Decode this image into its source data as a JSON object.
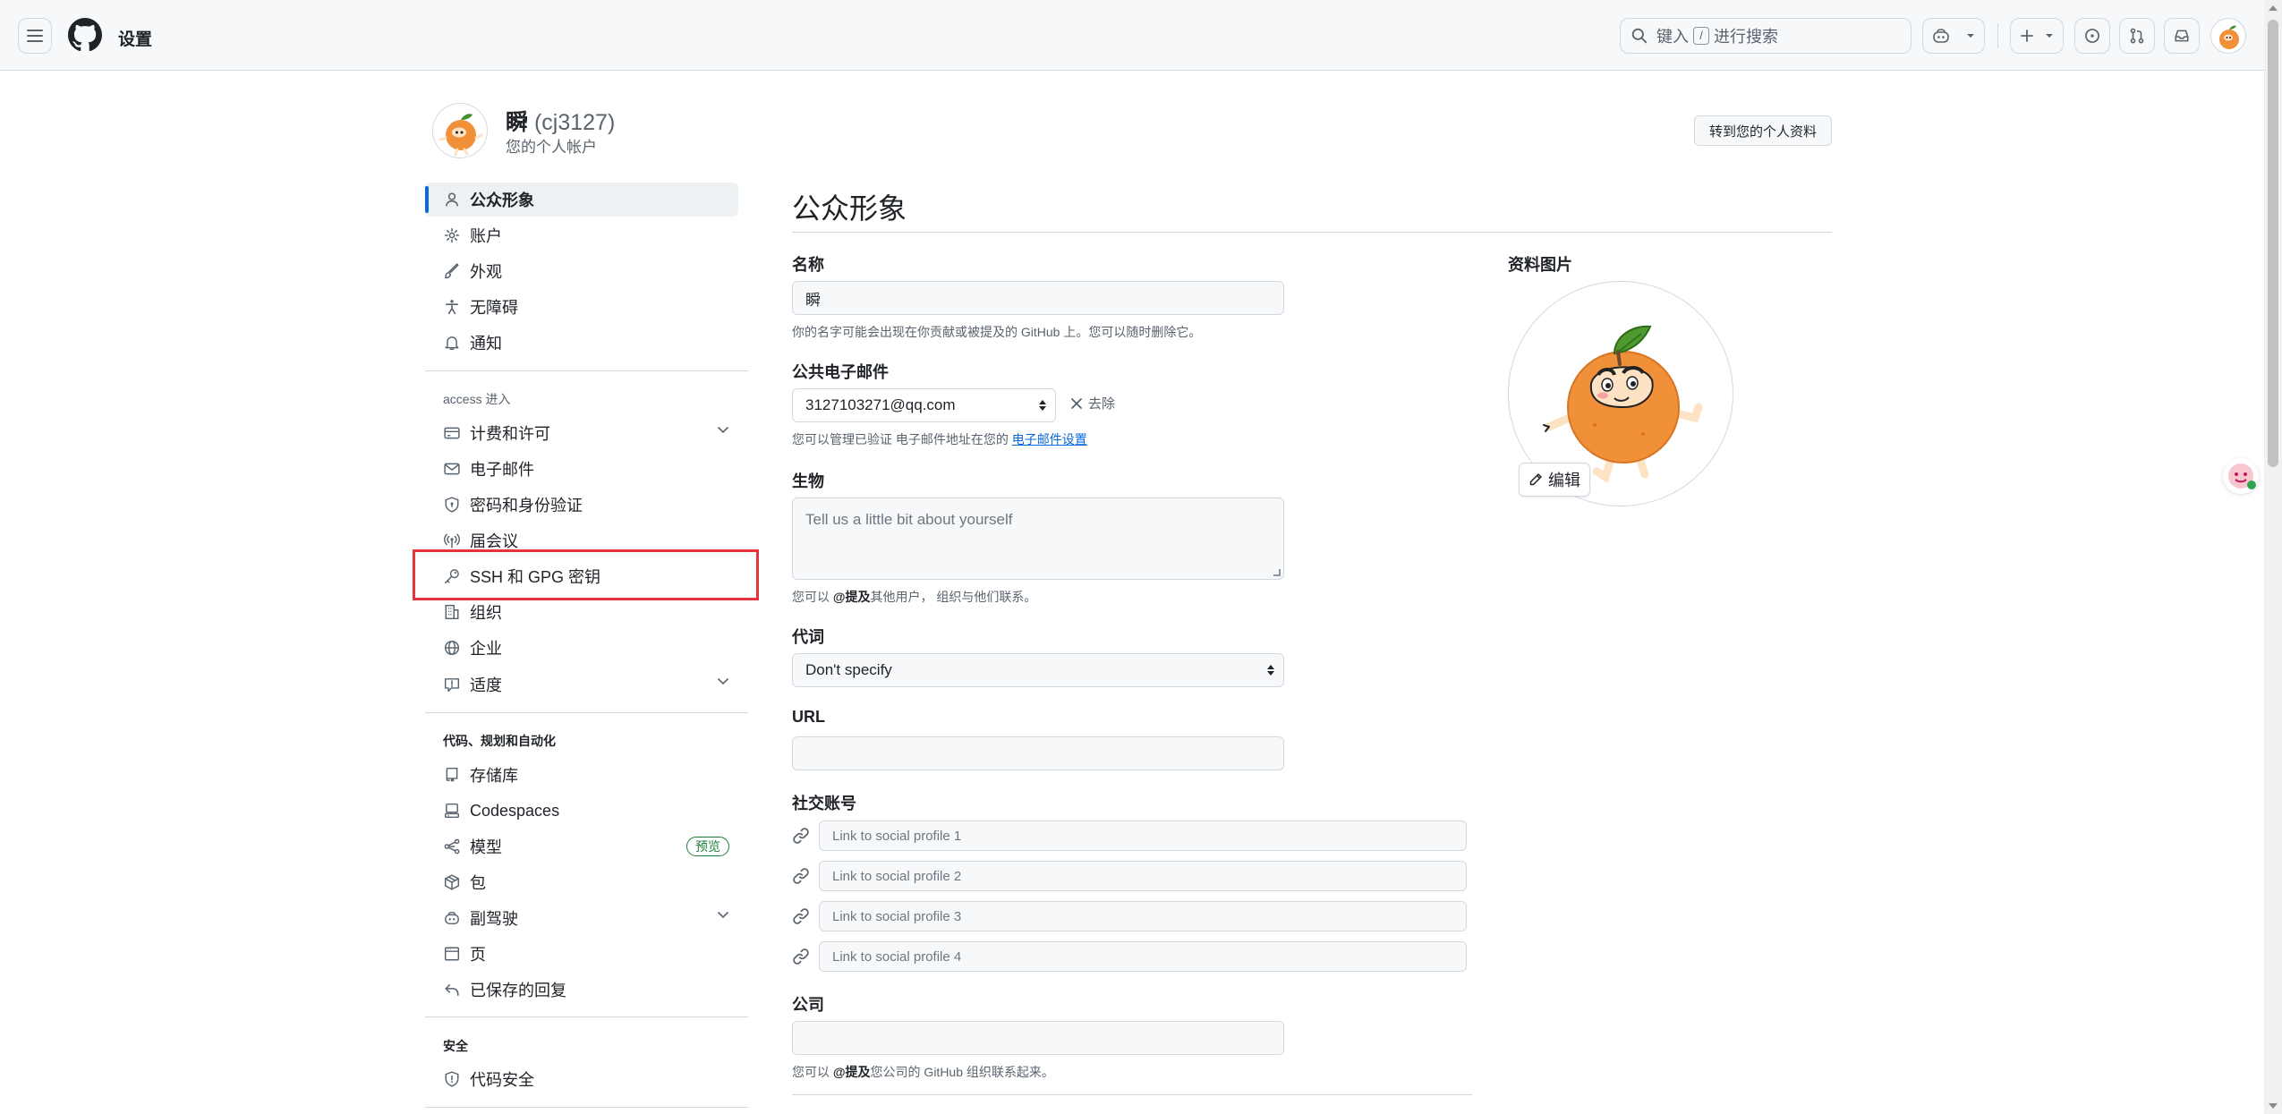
{
  "header": {
    "page_title": "设置",
    "search_prefix": "键入",
    "search_key": "/",
    "search_suffix": "进行搜索",
    "icons": [
      "menu-icon",
      "github-logo-icon",
      "search-icon",
      "copilot-icon",
      "plus-icon",
      "issue-icon",
      "pull-request-icon",
      "inbox-icon"
    ]
  },
  "profile": {
    "display_name": "瞬",
    "login": "(cj3127)",
    "subtitle": "您的个人帐户",
    "goto_profile_label": "转到您的个人资料"
  },
  "sidebar": {
    "group1": [
      {
        "label": "公众形象",
        "icon": "person-icon",
        "active": true
      },
      {
        "label": "账户",
        "icon": "gear-icon"
      },
      {
        "label": "外观",
        "icon": "paintbrush-icon"
      },
      {
        "label": "无障碍",
        "icon": "accessibility-icon"
      },
      {
        "label": "通知",
        "icon": "bell-icon"
      }
    ],
    "access_heading": "access 进入",
    "group2": [
      {
        "label": "计费和许可",
        "icon": "credit-card-icon",
        "expandable": true
      },
      {
        "label": "电子邮件",
        "icon": "mail-icon"
      },
      {
        "label": "密码和身份验证",
        "icon": "shield-lock-icon"
      },
      {
        "label": "届会议",
        "icon": "broadcast-icon"
      },
      {
        "label": "SSH 和 GPG 密钥",
        "icon": "key-icon",
        "highlighted": true
      },
      {
        "label": "组织",
        "icon": "organization-icon"
      },
      {
        "label": "企业",
        "icon": "globe-icon"
      },
      {
        "label": "适度",
        "icon": "report-icon",
        "expandable": true
      }
    ],
    "code_heading": "代码、规划和自动化",
    "group3": [
      {
        "label": "存储库",
        "icon": "repo-icon"
      },
      {
        "label": "Codespaces",
        "icon": "codespaces-icon"
      },
      {
        "label": "模型",
        "icon": "ai-model-icon",
        "badge": "预览"
      },
      {
        "label": "包",
        "icon": "package-icon"
      },
      {
        "label": "副驾驶",
        "icon": "copilot-icon",
        "expandable": true
      },
      {
        "label": "页",
        "icon": "browser-icon"
      },
      {
        "label": "已保存的回复",
        "icon": "reply-icon"
      }
    ],
    "security_heading": "安全",
    "group4": [
      {
        "label": "代码安全",
        "icon": "shield-check-icon"
      }
    ]
  },
  "main": {
    "title": "公众形象",
    "name_label": "名称",
    "name_value": "瞬",
    "name_note": "你的名字可能会出现在你贡献或被提及的 GitHub 上。您可以随时删除它。",
    "email_label": "公共电子邮件",
    "email_value": "3127103271@qq.com",
    "remove_label": "去除",
    "email_note_prefix": "您可以管理已验证 电子邮件地址在您的",
    "email_note_link": "电子邮件设置",
    "bio_label": "生物",
    "bio_placeholder": "Tell us a little bit about yourself",
    "bio_note_prefix": "您可以",
    "bio_note_mention": "@提及",
    "bio_note_suffix": "其他用户， 组织与他们联系。",
    "pronoun_label": "代词",
    "pronoun_value": "Don't specify",
    "url_label": "URL",
    "url_value": "",
    "social_label": "社交账号",
    "social_placeholders": [
      "Link to social profile 1",
      "Link to social profile 2",
      "Link to social profile 3",
      "Link to social profile 4"
    ],
    "company_label": "公司",
    "company_value": "",
    "company_note_prefix": "您可以",
    "company_note_mention": "@提及",
    "company_note_suffix": "您公司的 GitHub 组织联系起来。"
  },
  "picture": {
    "label": "资料图片",
    "edit_label": "编辑"
  },
  "colors": {
    "accent": "#0969da",
    "highlight_box": "#e5343b",
    "badge_green": "#1a7f37",
    "avatar_orange": "#f0913a"
  }
}
